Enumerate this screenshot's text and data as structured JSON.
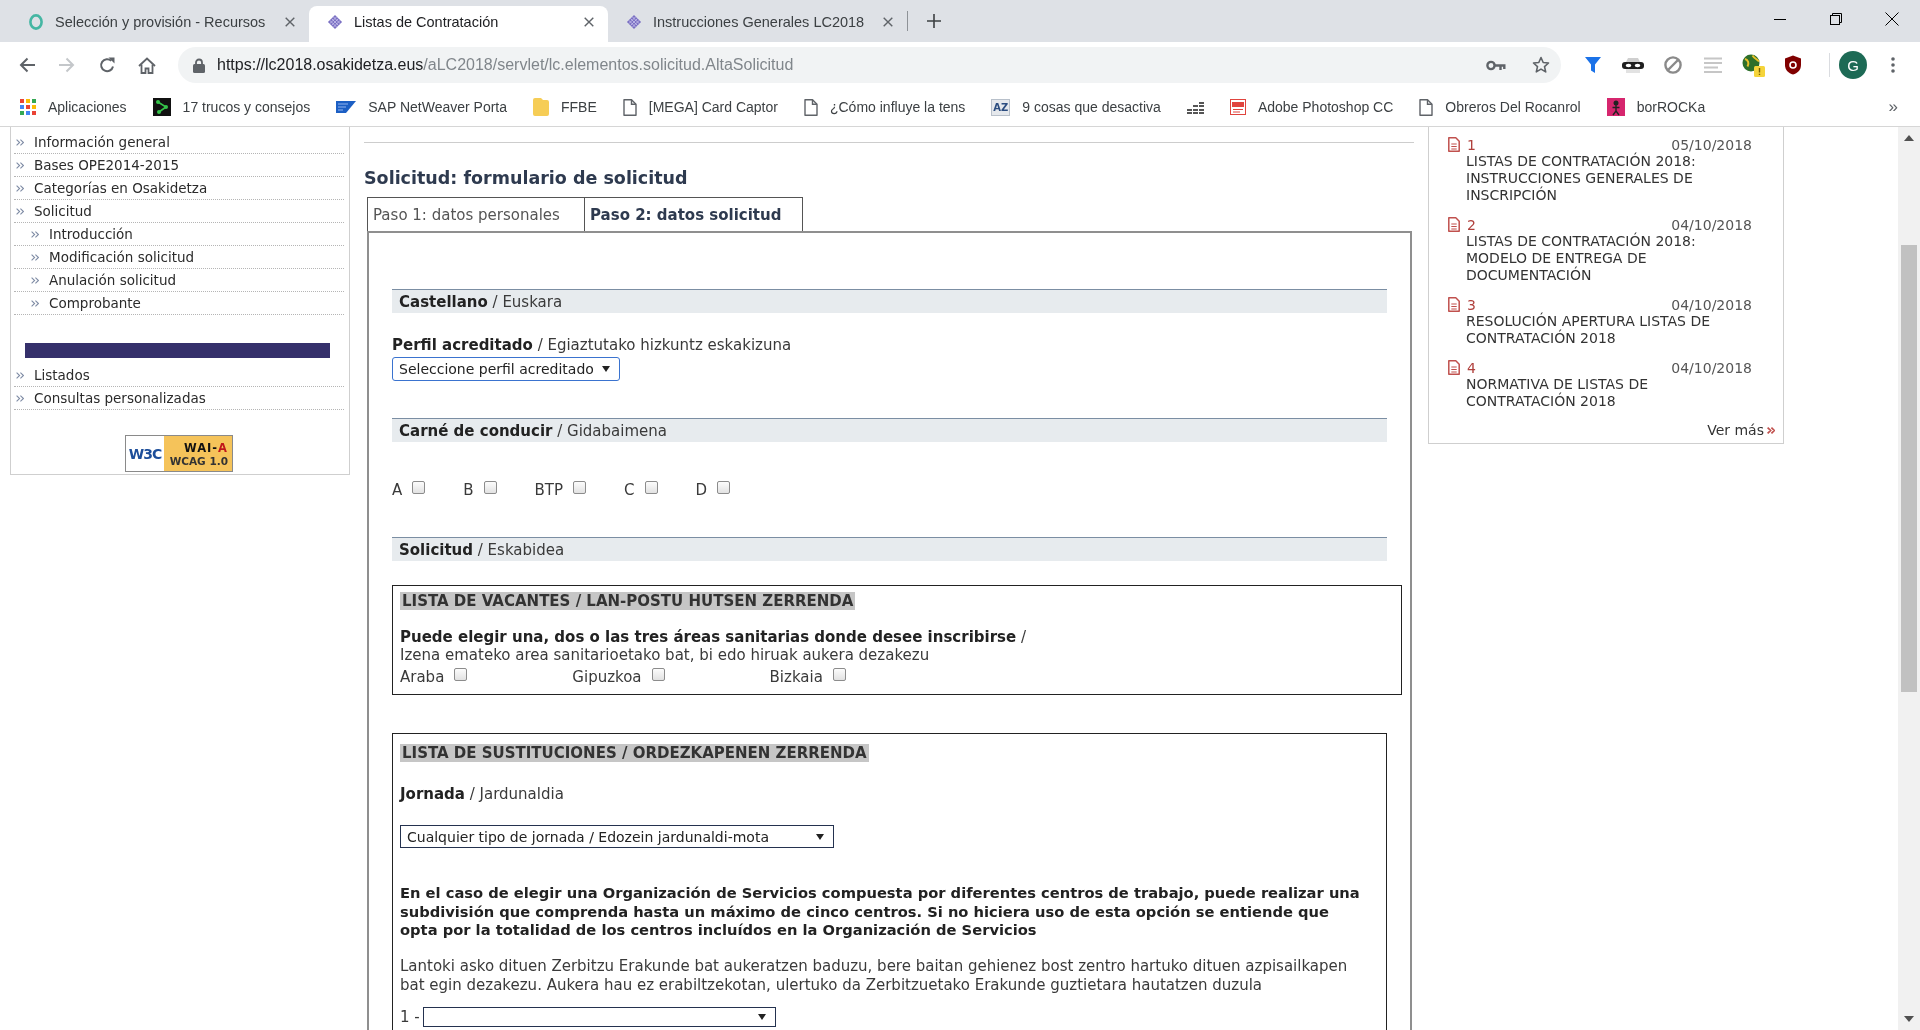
{
  "browser": {
    "tabs": [
      {
        "title": "Selección y provisión - Recursos",
        "selected": false
      },
      {
        "title": "Listas de Contratación",
        "selected": true
      },
      {
        "title": "Instrucciones Generales LC2018",
        "selected": false
      }
    ],
    "can_go_forward": false,
    "address": {
      "origin": "https://lc2018.osakidetza.eus",
      "path": "/aLC2018/servlet/lc.elementos.solicitud.AltaSolicitud"
    },
    "profile_initial": "G",
    "bookmarks": [
      {
        "kind": "apps",
        "label": "Aplicaciones"
      },
      {
        "kind": "favicon",
        "label": "17 trucos y consejos"
      },
      {
        "kind": "favicon",
        "label": "SAP NetWeaver Porta"
      },
      {
        "kind": "folder",
        "label": "FFBE"
      },
      {
        "kind": "page",
        "label": "[MEGA] Card Captor"
      },
      {
        "kind": "page",
        "label": "¿Cómo influye la tens"
      },
      {
        "kind": "favicon",
        "icon_text": "AZ",
        "label": "9 cosas que desactiva"
      },
      {
        "kind": "favicon"
      },
      {
        "kind": "favicon",
        "label": "Adobe Photoshop CC"
      },
      {
        "kind": "page",
        "label": "Obreros Del Rocanrol"
      },
      {
        "kind": "favicon",
        "label": "borROCKa"
      }
    ],
    "bookmarks_overflow": "»"
  },
  "sidebar": {
    "menu": [
      {
        "label": "Información general"
      },
      {
        "label": "Bases OPE2014-2015"
      },
      {
        "label": "Categorías en Osakidetza"
      },
      {
        "label": "Solicitud",
        "children": [
          {
            "label": "Introducción"
          },
          {
            "label": "Modificación solicitud"
          },
          {
            "label": "Anulación solicitud"
          },
          {
            "label": "Comprobante"
          }
        ]
      }
    ],
    "links": [
      {
        "label": "Listados"
      },
      {
        "label": "Consultas personalizadas"
      }
    ],
    "badge": {
      "mark": "W3C",
      "program": "WAI-",
      "grade": "A",
      "standard": "WCAG 1.0"
    }
  },
  "form": {
    "title": "Solicitud: formulario de solicitud",
    "steps": [
      {
        "label": "Paso 1: datos personales",
        "selected": false
      },
      {
        "label": "Paso 2: datos solicitud",
        "selected": true
      }
    ],
    "language": {
      "header": "**Castellano** / Euskara",
      "label": "**Perfil acreditado** / Egiaztutako hizkuntz eskakizuna",
      "select": {
        "value": "Seleccione perfil acreditado",
        "focused": true
      }
    },
    "license": {
      "header": "**Carné de conducir** / Gidabaimena",
      "options": [
        {
          "label": "A",
          "checked": false
        },
        {
          "label": "B",
          "checked": false
        },
        {
          "label": "BTP",
          "checked": false
        },
        {
          "label": "C",
          "checked": false
        },
        {
          "label": "D",
          "checked": false
        }
      ]
    },
    "request": {
      "header": "**Solicitud** / Eskabidea",
      "vacancies": {
        "title": "LISTA DE VACANTES / LAN-POSTU HUTSEN ZERRENDA",
        "prompt": "**Puede elegir una, dos o las tres áreas sanitarias donde desee inscribirse** /",
        "prompt_translation": "Izena emateko area sanitarioetako bat, bi edo hiruak aukera dezakezu",
        "options": [
          {
            "label": "Araba",
            "checked": false
          },
          {
            "label": "Gipuzkoa",
            "checked": false
          },
          {
            "label": "Bizkaia",
            "checked": false
          }
        ]
      },
      "substitutions": {
        "title": "LISTA DE SUSTITUCIONES / ORDEZKAPENEN ZERRENDA",
        "label": "**Jornada** / Jardunaldia",
        "select": {
          "value": "Cualquier tipo de jornada / Edozein jardunaldi-mota",
          "focused": false
        },
        "note": "En el caso de elegir una Organización de Servicios compuesta por diferentes centros de trabajo, puede realizar una subdivisión que comprenda hasta un máximo de cinco centros. Si no hiciera uso de esta opción se entiende que opta por la totalidad de los centros incluídos en la Organización de Servicios",
        "note_translation": "Lantoki asko dituen Zerbitzu Erakunde bat aukeratzen baduzu, bere baitan gehienez bost zentro hartuko dituen azpisailkapen bat egin dezakezu. Aukera hau ez erabiltzekotan, ulertuko da Zerbitzuetako Erakunde guztietara hautatzen duzula",
        "centers": [
          {
            "label": "1 -",
            "select": {
              "focused": false
            }
          }
        ]
      }
    }
  },
  "news": {
    "items": [
      {
        "number": "1",
        "date": "05/10/2018",
        "title": "LISTAS DE CONTRATACIÓN 2018: INSTRUCCIONES GENERALES DE INSCRIPCIÓN"
      },
      {
        "number": "2",
        "date": "04/10/2018",
        "title": "LISTAS DE CONTRATACIÓN 2018: MODELO DE ENTREGA DE DOCUMENTACIÓN"
      },
      {
        "number": "3",
        "date": "04/10/2018",
        "title": "RESOLUCIÓN APERTURA LISTAS DE CONTRATACIÓN 2018"
      },
      {
        "number": "4",
        "date": "04/10/2018",
        "title": "NORMATIVA DE LISTAS DE CONTRATACIÓN 2018"
      }
    ],
    "more": "Ver más"
  }
}
